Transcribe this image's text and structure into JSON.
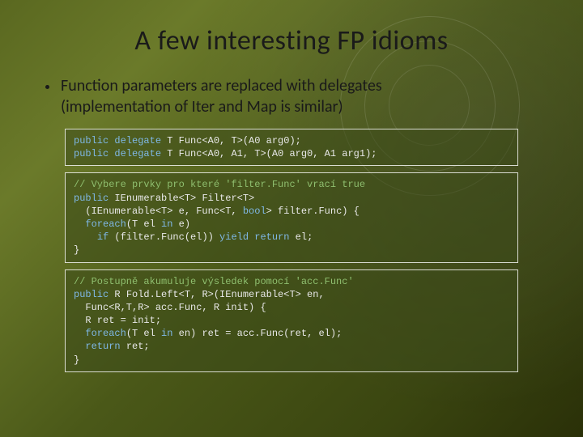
{
  "title": "A few interesting FP idioms",
  "bullet1_line1": "Function parameters are replaced with delegates",
  "bullet1_line2": "(implementation of Iter and Map is similar)",
  "code1": {
    "l1a": "public",
    "l1b": " ",
    "l1c": "delegate",
    "l1d": " T Func<A0, T>(A0 arg0);",
    "l2a": "public",
    "l2b": " ",
    "l2c": "delegate",
    "l2d": " T Func<A0, A1, T>(A0 arg0, A1 arg1);"
  },
  "code2": {
    "c1": "// Vybere prvky pro které 'filter.Func' vrací true",
    "l1a": "public",
    "l1b": " IEnumerable<T> Filter<T>",
    "l2": "  (IEnumerable<T> e, Func<T, ",
    "l2b": "bool",
    "l2c": "> filter.Func) {",
    "l3a": "  ",
    "l3b": "foreach",
    "l3c": "(T el ",
    "l3d": "in",
    "l3e": " e)",
    "l4a": "    ",
    "l4b": "if",
    "l4c": " (filter.Func(el)) ",
    "l4d": "yield",
    "l4e": " ",
    "l4f": "return",
    "l4g": " el;",
    "l5": "}"
  },
  "code3": {
    "c1": "// Postupně akumuluje výsledek pomocí 'acc.Func'",
    "l1a": "public",
    "l1b": " R Fold.Left<T, R>(IEnumerable<T> en,",
    "l2": "  Func<R,T,R> acc.Func, R init) {",
    "l3": "  R ret = init;",
    "l4a": "  ",
    "l4b": "foreach",
    "l4c": "(T el ",
    "l4d": "in",
    "l4e": " en) ret = acc.Func(ret, el);",
    "l5a": "  ",
    "l5b": "return",
    "l5c": " ret;",
    "l6": "}"
  }
}
